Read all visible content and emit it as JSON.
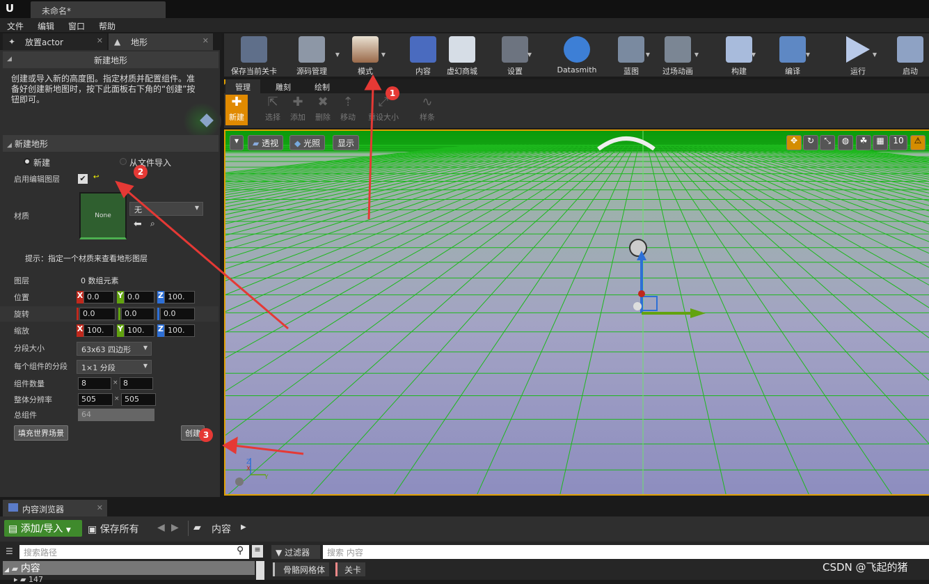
{
  "window": {
    "doc_tab": "未命名*"
  },
  "menu": [
    "文件",
    "编辑",
    "窗口",
    "帮助"
  ],
  "left_tabs": [
    {
      "label": "放置actor"
    },
    {
      "label": "地形"
    }
  ],
  "new_landscape": {
    "header": "新建地形",
    "description": "创建或导入新的高度图。指定材质并配置组件。准备好创建新地图时，按下此面板右下角的“创建”按钮即可。",
    "section": "新建地形",
    "option_new": "新建",
    "option_import": "从文件导入",
    "enable_layers_label": "启用编辑图层",
    "material_label": "材质",
    "material_thumb": "None",
    "material_combo": "无",
    "hint": "提示：指定一个材质来查看地形图层",
    "layers_label": "图层",
    "layers_value": "0 数组元素",
    "location_label": "位置",
    "location": [
      "0.0",
      "0.0",
      "100."
    ],
    "rotation_label": "旋转",
    "rotation": [
      "0.0",
      "0.0",
      "0.0"
    ],
    "scale_label": "缩放",
    "scale": [
      "100.",
      "100.",
      "100."
    ],
    "section_size_label": "分段大小",
    "section_size": "63x63 四边形",
    "sections_per_label": "每个组件的分段",
    "sections_per": "1×1 分段",
    "num_components_label": "组件数量",
    "num_components": [
      "8",
      "8"
    ],
    "resolution_label": "整体分辨率",
    "resolution": [
      "505",
      "505"
    ],
    "total_label": "总组件",
    "total": "64",
    "fill_button": "填充世界场景",
    "create_button": "创建"
  },
  "toolbar": [
    {
      "label": "保存当前关卡",
      "icon": "save-icon"
    },
    {
      "label": "源码管理",
      "icon": "source-control-icon"
    },
    {
      "label": "模式",
      "icon": "modes-icon"
    },
    {
      "label": "内容",
      "icon": "content-icon"
    },
    {
      "label": "虚幻商城",
      "icon": "marketplace-icon"
    },
    {
      "label": "设置",
      "icon": "settings-icon"
    },
    {
      "label": "Datasmith",
      "icon": "datasmith-icon"
    },
    {
      "label": "蓝图",
      "icon": "blueprint-icon"
    },
    {
      "label": "过场动画",
      "icon": "cinematics-icon"
    },
    {
      "label": "构建",
      "icon": "build-icon"
    },
    {
      "label": "编译",
      "icon": "compile-icon"
    },
    {
      "label": "运行",
      "icon": "play-icon"
    },
    {
      "label": "启动",
      "icon": "launch-icon"
    }
  ],
  "mode_tabs": [
    "管理",
    "雕刻",
    "绘制"
  ],
  "mode_tools": [
    "新建",
    "选择",
    "添加",
    "删除",
    "移动",
    "重设大小",
    "样条"
  ],
  "viewport": {
    "perspective": "透视",
    "lit": "光照",
    "show": "显示",
    "snap_value": "10"
  },
  "content_browser": {
    "tab": "内容浏览器",
    "add_import": "添加/导入",
    "save_all": "保存所有",
    "path_root": "内容",
    "search_paths": "搜索路径",
    "filter": "过滤器",
    "search_content": "搜索 内容",
    "tree_root": "内容",
    "tree_child": "147",
    "filter_chips": [
      "骨骼网格体",
      "关卡"
    ]
  },
  "annotations": [
    "1",
    "2",
    "3"
  ],
  "watermark": "CSDN @飞起的猪"
}
